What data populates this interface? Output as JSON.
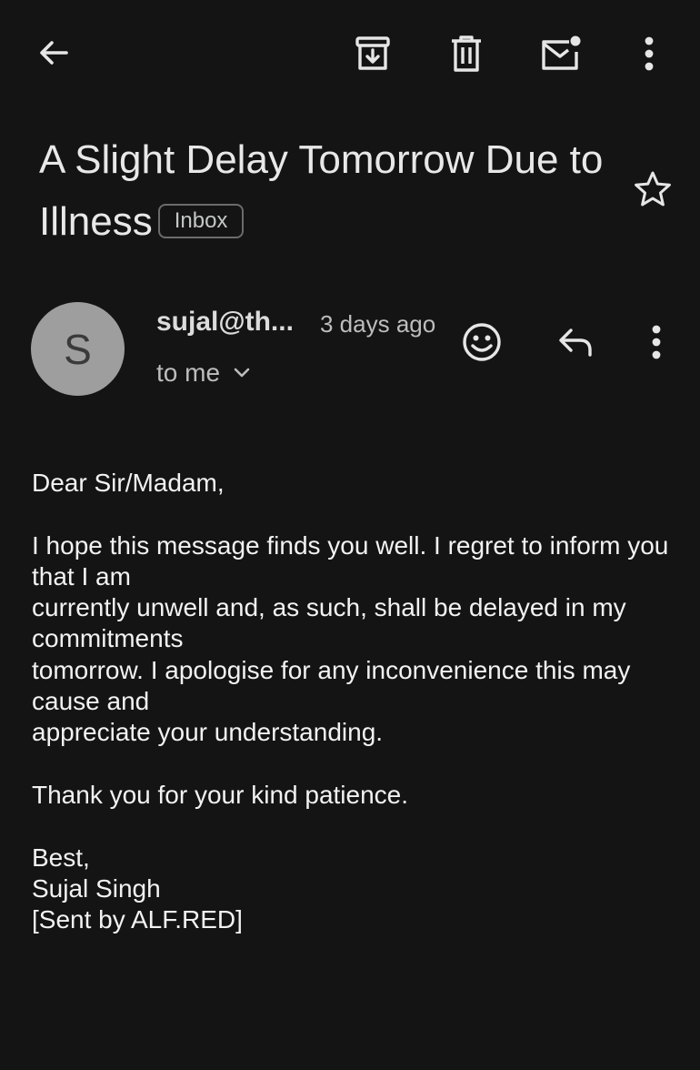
{
  "toolbar": {
    "back_icon": "arrow-left-icon",
    "archive_icon": "archive-icon",
    "delete_icon": "trash-icon",
    "mark_unread_icon": "mail-unread-icon",
    "more_icon": "more-vert-icon"
  },
  "email": {
    "subject": "A Slight Delay Tomorrow Due to Illness",
    "label": "Inbox",
    "starred": false,
    "sender": {
      "avatar_letter": "S",
      "display": "sujal@th...",
      "time": "3 days ago",
      "recipients": "to me"
    },
    "body": {
      "greeting": "Dear Sir/Madam,",
      "para1": [
        "I hope this message finds you well. I regret to inform you that I am",
        "currently unwell and, as such, shall be delayed in my commitments",
        "tomorrow. I apologise for any inconvenience this may cause and",
        "appreciate your understanding."
      ],
      "para2": "Thank you for your kind patience.",
      "signoff": "Best,",
      "name": "Sujal Singh",
      "footer": "[Sent by ALF.RED]"
    }
  },
  "colors": {
    "background": "#141414",
    "text": "#e6e6e6",
    "icon": "#e6e6e6",
    "avatar_bg": "#9e9e9e"
  }
}
